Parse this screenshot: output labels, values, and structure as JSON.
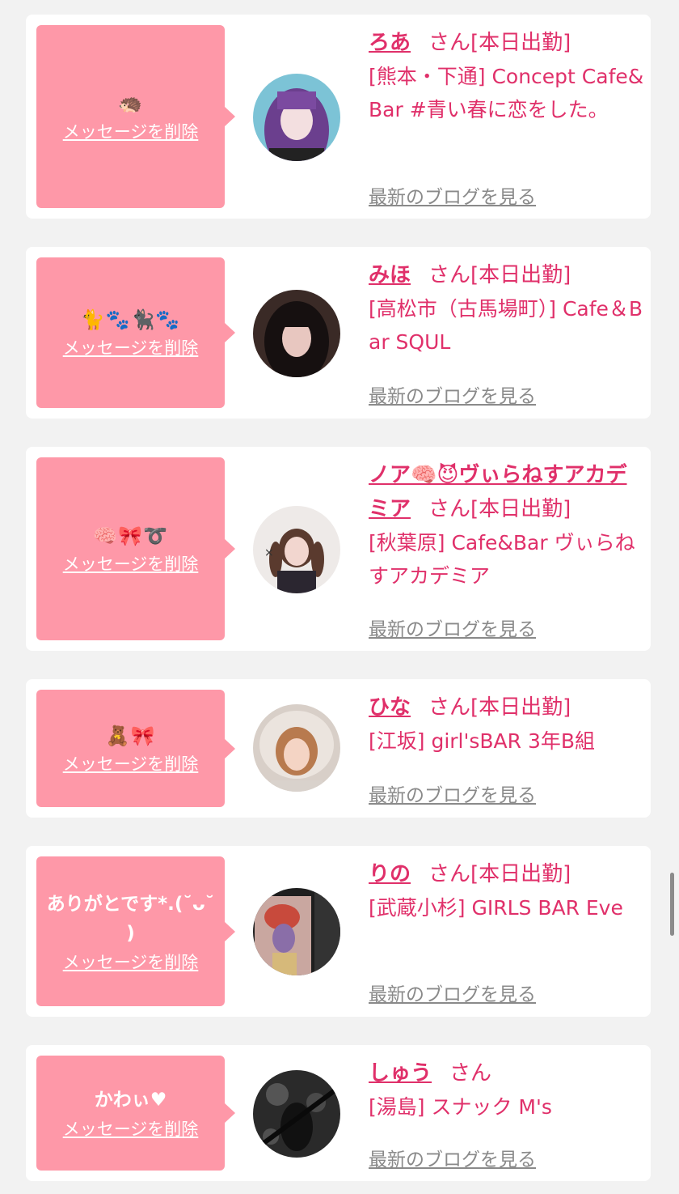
{
  "entries": [
    {
      "message": "",
      "emoji": "🦔",
      "delete_label": "メッセージを削除",
      "name": "ろあ",
      "honorific": "さん",
      "status": "[本日出勤]",
      "shop": "[熊本・下通] Concept Cafe&Bar #青い春に恋をした。",
      "blog_label": "最新のブログを見る",
      "avatar_icon": "avatar-photo-purple-hair"
    },
    {
      "message": "",
      "emoji": "🐈🐾🐈‍⬛🐾",
      "delete_label": "メッセージを削除",
      "name": "みほ",
      "honorific": "さん",
      "status": "[本日出勤]",
      "shop": "[高松市（古馬場町）] Cafe＆Bar SQUL",
      "blog_label": "最新のブログを見る",
      "avatar_icon": "avatar-photo-black-hair"
    },
    {
      "message": "",
      "emoji": "🧠🎀➰",
      "delete_label": "メッセージを削除",
      "name": "ノア🧠😈ヴぃらねすアカデミア",
      "honorific": "さん",
      "status": "[本日出勤]",
      "shop": "[秋葉原] Cafe&Bar ヴぃらねすアカデミア",
      "blog_label": "最新のブログを見る",
      "avatar_icon": "avatar-photo-twin-tails"
    },
    {
      "message": "",
      "emoji": "🧸🎀",
      "delete_label": "メッセージを削除",
      "name": "ひな",
      "honorific": "さん",
      "status": "[本日出勤]",
      "shop": "[江坂] girl'sBAR 3年B組",
      "blog_label": "最新のブログを見る",
      "avatar_icon": "avatar-photo-fur-hood"
    },
    {
      "message": "ありがとです*.(˘ᴗ˘ )",
      "emoji": "",
      "delete_label": "メッセージを削除",
      "name": "りの",
      "honorific": "さん",
      "status": "[本日出勤]",
      "shop": "[武蔵小杉] GIRLS BAR Eve",
      "blog_label": "最新のブログを見る",
      "avatar_icon": "avatar-photo-art-poster"
    },
    {
      "message": "かわぃ♥",
      "emoji": "",
      "delete_label": "メッセージを削除",
      "name": "しゅう",
      "honorific": "さん",
      "status": "",
      "shop": "[湯島] スナック M's",
      "blog_label": "最新のブログを見る",
      "avatar_icon": "avatar-photo-monochrome"
    }
  ],
  "colors": {
    "accent": "#e0306a",
    "bubble": "#fe98a8",
    "background": "#f2f2f2",
    "link_gray": "#8a8a8a"
  }
}
